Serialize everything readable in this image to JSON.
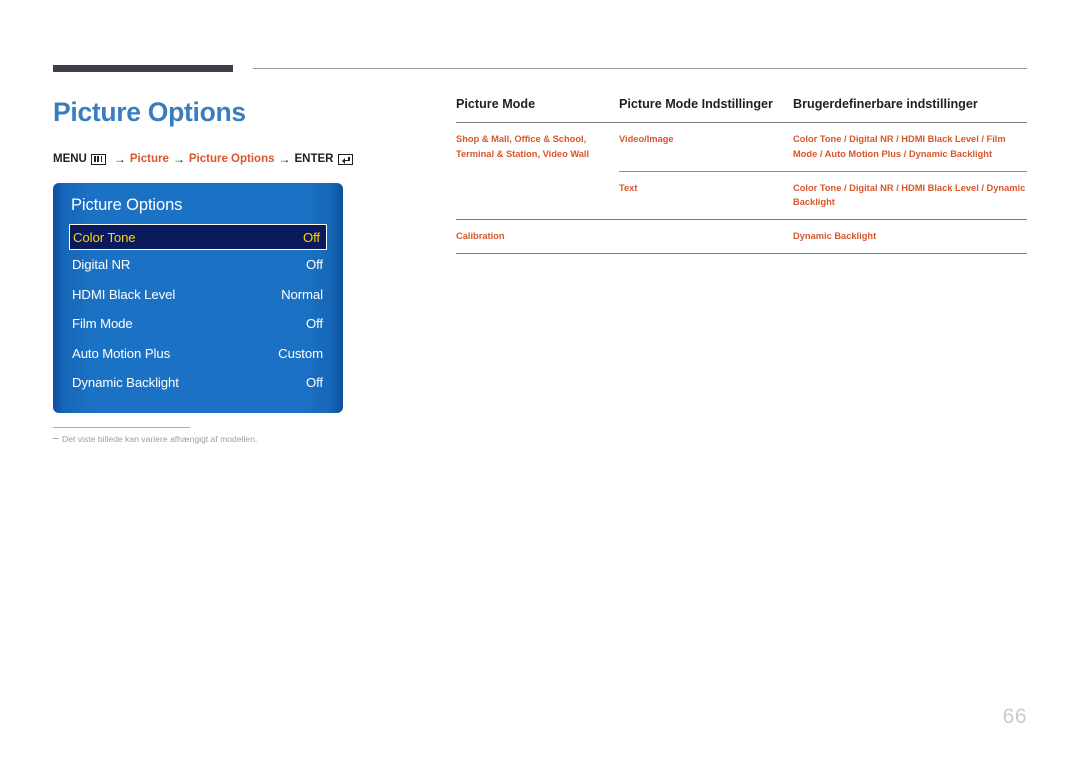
{
  "page": {
    "title": "Picture Options",
    "number": "66"
  },
  "menu_path": {
    "prefix": "MENU",
    "menu_icon": "menu-grid-icon",
    "steps": [
      "Picture",
      "Picture Options"
    ],
    "arrow": "→",
    "suffix": "ENTER",
    "enter_icon": "enter-return-icon"
  },
  "osd": {
    "header": "Picture Options",
    "items": [
      {
        "label": "Color Tone",
        "value": "Off",
        "selected": true
      },
      {
        "label": "Digital NR",
        "value": "Off",
        "selected": false
      },
      {
        "label": "HDMI Black Level",
        "value": "Normal",
        "selected": false
      },
      {
        "label": "Film Mode",
        "value": "Off",
        "selected": false
      },
      {
        "label": "Auto Motion Plus",
        "value": "Custom",
        "selected": false
      },
      {
        "label": "Dynamic Backlight",
        "value": "Off",
        "selected": false
      }
    ]
  },
  "footnote": {
    "text": "Det viste billede kan variere afhængigt af modellen."
  },
  "table": {
    "headers": {
      "col1": "Picture Mode",
      "col2": "Picture Mode Indstillinger",
      "col3": "Brugerdefinerbare indstillinger"
    },
    "rows": [
      {
        "col1": "Shop & Mall, Office & School, Terminal & Station, Video Wall",
        "col2": "Video/Image",
        "col3": "Color Tone / Digital NR / HDMI Black Level / Film Mode / Auto Motion Plus / Dynamic Backlight"
      },
      {
        "col1": "",
        "col2": "Text",
        "col3": "Color Tone / Digital NR / HDMI Black Level / Dynamic Backlight"
      },
      {
        "col1": "Calibration",
        "col2": "",
        "col3": "Dynamic Backlight"
      }
    ]
  },
  "colors": {
    "accent_blue": "#3a7dbe",
    "accent_orange": "#d9562b",
    "osd_blue": "#1b72c4",
    "osd_selected_bg": "#0b1a5c",
    "osd_selected_text": "#ffd400",
    "rule_dark": "#3f3d4b",
    "page_number": "#c9c9ce"
  }
}
